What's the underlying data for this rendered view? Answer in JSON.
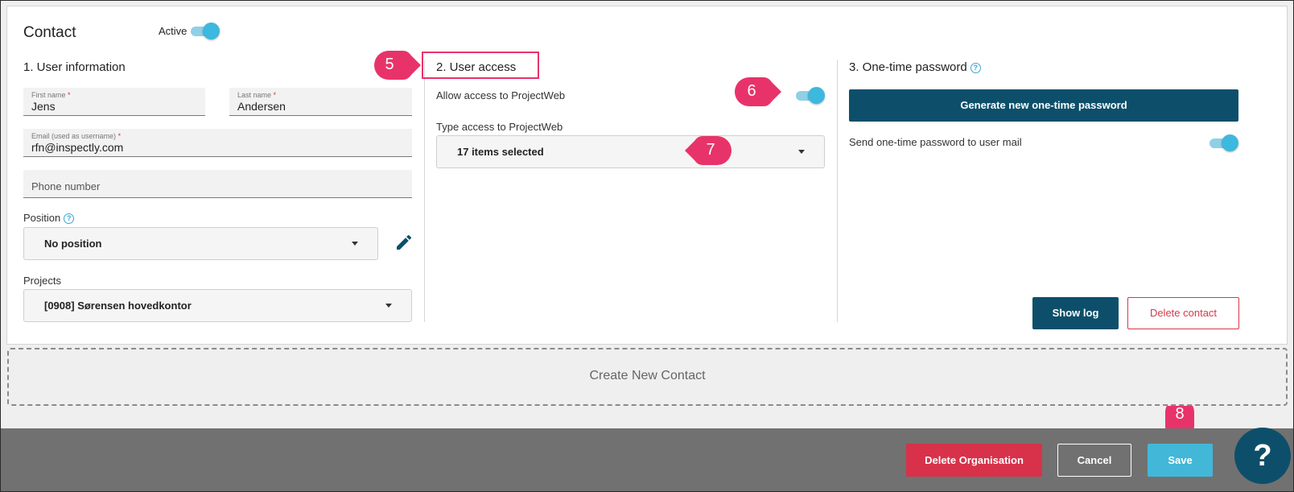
{
  "header": {
    "title": "Contact",
    "active_label": "Active",
    "active_on": true
  },
  "user_info": {
    "heading": "1. User information",
    "first_name": {
      "label": "First name",
      "required": "*",
      "value": "Jens"
    },
    "last_name": {
      "label": "Last name",
      "required": "*",
      "value": "Andersen"
    },
    "email": {
      "label": "Email (used as username)",
      "required": "*",
      "value": "rfn@inspectly.com"
    },
    "phone": {
      "placeholder": "Phone number"
    },
    "position": {
      "label": "Position",
      "help": "?",
      "value": "No position"
    },
    "projects": {
      "label": "Projects",
      "value": "[0908] Sørensen hovedkontor"
    }
  },
  "user_access": {
    "heading": "2. User access",
    "allow_label": "Allow access to ProjectWeb",
    "allow_on": true,
    "type_label": "Type access to ProjectWeb",
    "type_value": "17 items selected"
  },
  "otp": {
    "heading": "3. One-time password",
    "help": "?",
    "generate_label": "Generate new one-time password",
    "send_label": "Send one-time password to user mail",
    "send_on": true,
    "show_log": "Show log",
    "delete_contact": "Delete contact"
  },
  "create_new": "Create New Contact",
  "footer": {
    "delete_org": "Delete Organisation",
    "cancel": "Cancel",
    "save": "Save",
    "help": "?"
  },
  "callouts": [
    "5",
    "6",
    "7",
    "8"
  ],
  "colors": {
    "accent": "#3db8de",
    "primary": "#0d4f6a",
    "danger": "#d23a4b",
    "callout": "#e8336a"
  }
}
